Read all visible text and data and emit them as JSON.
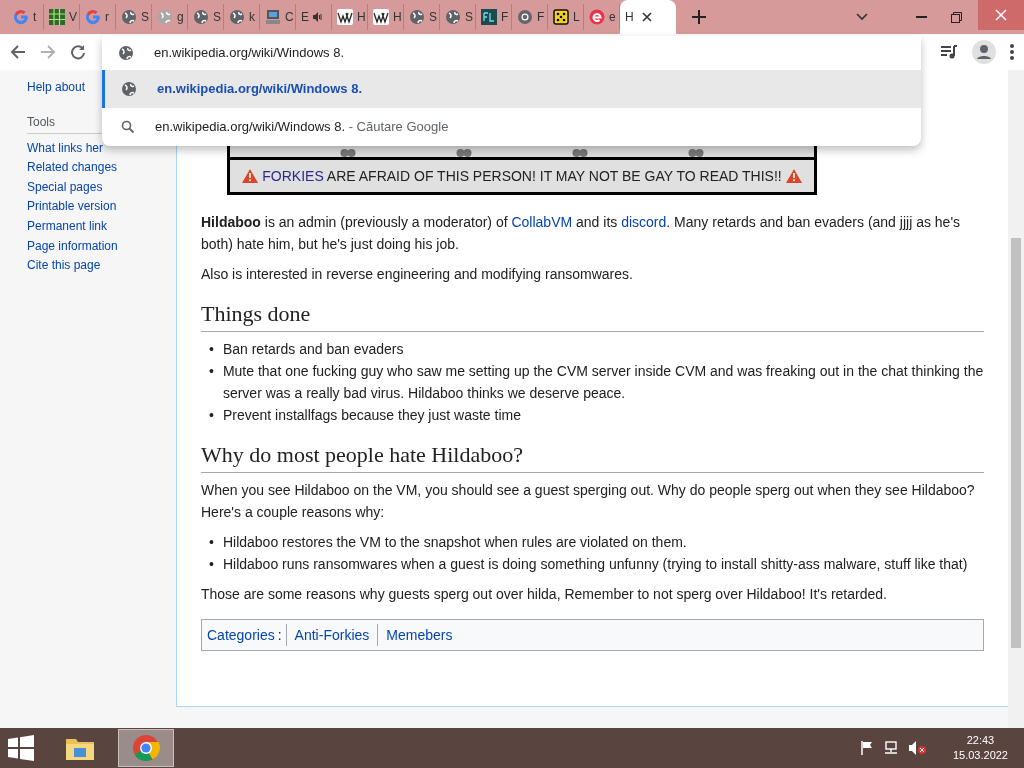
{
  "tabs": [
    {
      "kind": "google",
      "label": "t",
      "selected": false
    },
    {
      "kind": "grid",
      "label": "V",
      "selected": false
    },
    {
      "kind": "google",
      "label": "r",
      "selected": false
    },
    {
      "kind": "globe",
      "label": "S",
      "selected": false
    },
    {
      "kind": "globe-faded",
      "label": "g",
      "selected": false
    },
    {
      "kind": "globe",
      "label": "S",
      "selected": false
    },
    {
      "kind": "globe",
      "label": "k",
      "selected": false
    },
    {
      "kind": "computer",
      "label": "C",
      "selected": false
    },
    {
      "kind": "plain",
      "label": "E",
      "audio": true,
      "selected": false
    },
    {
      "kind": "wiki",
      "label": "H",
      "selected": false
    },
    {
      "kind": "wiki",
      "label": "H",
      "selected": false
    },
    {
      "kind": "globe",
      "label": "S",
      "selected": false
    },
    {
      "kind": "globe",
      "label": "S",
      "selected": false
    },
    {
      "kind": "fl",
      "label": "F",
      "selected": false
    },
    {
      "kind": "chrome",
      "label": "F",
      "selected": false
    },
    {
      "kind": "dice",
      "label": "L",
      "selected": false
    },
    {
      "kind": "e",
      "label": "e",
      "selected": false
    },
    {
      "kind": "plain",
      "label": "H",
      "selected": true
    }
  ],
  "omnibox": {
    "value": "en.wikipedia.org/wiki/Windows 8."
  },
  "suggestions": [
    {
      "kind": "url",
      "text": "en.wikipedia.org/wiki/Windows 8.",
      "selected": true
    },
    {
      "kind": "search",
      "text": "en.wikipedia.org/wiki/Windows 8.",
      "suffix": "- Căutare Google",
      "selected": false
    }
  ],
  "sidebar": {
    "items": [
      {
        "kind": "link",
        "text": "Help about"
      },
      {
        "kind": "heading",
        "text": "Tools"
      },
      {
        "kind": "link",
        "text": "What links her"
      },
      {
        "kind": "link",
        "text": "Related changes"
      },
      {
        "kind": "link",
        "text": "Special pages"
      },
      {
        "kind": "link",
        "text": "Printable version"
      },
      {
        "kind": "link",
        "text": "Permanent link"
      },
      {
        "kind": "link",
        "text": "Page information"
      },
      {
        "kind": "link",
        "text": "Cite this page"
      }
    ]
  },
  "banner": {
    "segments": [
      {
        "text": "FORKIES",
        "kind": "link"
      },
      {
        "text": " ARE AFRAID OF THIS PERSON! IT MAY NOT BE GAY TO READ THIS!!",
        "kind": "text"
      }
    ]
  },
  "content": [
    {
      "kind": "p",
      "segments": [
        {
          "text": "Hildaboo",
          "kind": "bold"
        },
        {
          "text": " is an admin (previously a moderator) of "
        },
        {
          "text": "CollabVM",
          "kind": "link"
        },
        {
          "text": " and its "
        },
        {
          "text": "discord",
          "kind": "link"
        },
        {
          "text": ". Many retards and ban evaders (and jjjj as he's both) hate him, but he's just doing his job."
        }
      ]
    },
    {
      "kind": "p",
      "segments": [
        {
          "text": "Also is interested in reverse engineering and modifying ransomwares."
        }
      ]
    },
    {
      "kind": "h2",
      "text": "Things done"
    },
    {
      "kind": "ul",
      "marker": "•",
      "items": [
        "Ban retards and ban evaders",
        "Mute that one fucking guy who saw me setting up the CVM server inside CVM and was freaking out in the chat thinking the server was a really bad virus. Hildaboo thinks we deserve peace.",
        "Prevent installfags because they just waste time"
      ]
    },
    {
      "kind": "h2",
      "text": "Why do most people hate Hildaboo?"
    },
    {
      "kind": "p",
      "segments": [
        {
          "text": "When you see Hildaboo on the VM, you should see a guest sperging out. Why do people sperg out when they see Hildaboo? Here's a couple reasons why:"
        }
      ]
    },
    {
      "kind": "ul",
      "marker": "•",
      "items": [
        "Hildaboo restores the VM to the snapshot when rules are violated on them.",
        "Hildaboo runs ransomwares when a guest is doing something unfunny (trying to install shitty-ass malware, stuff like that)"
      ]
    },
    {
      "kind": "p",
      "segments": [
        {
          "text": "Those are some reasons why guests sperg out over hilda, Remember to not sperg over Hildaboo! It's retarded."
        }
      ]
    }
  ],
  "categories": {
    "label": "Categories",
    "colon": ":",
    "items": [
      "Anti-Forkies",
      "Memebers"
    ]
  },
  "taskbar": {
    "apps": [
      {
        "kind": "explorer",
        "active": false
      },
      {
        "kind": "chrome",
        "active": true
      }
    ],
    "time": "22:43",
    "date": "15.03.2022"
  }
}
